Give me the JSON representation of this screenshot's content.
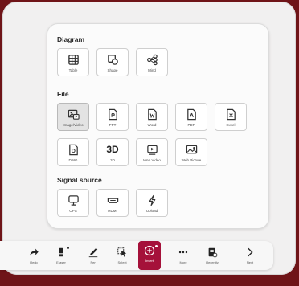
{
  "panel": {
    "sections": {
      "diagram": {
        "title": "Diagram",
        "items": [
          {
            "label": "Table",
            "icon": "table-icon"
          },
          {
            "label": "Shape",
            "icon": "shape-icon"
          },
          {
            "label": "Mind",
            "icon": "mind-map-icon"
          }
        ]
      },
      "file": {
        "title": "File",
        "row1": [
          {
            "label": "Image/Video",
            "icon": "image-video-icon",
            "selected": true
          },
          {
            "label": "PPT",
            "icon": "ppt-file-icon"
          },
          {
            "label": "Word",
            "icon": "word-file-icon"
          },
          {
            "label": "PDF",
            "icon": "pdf-file-icon"
          },
          {
            "label": "Excel",
            "icon": "excel-file-icon"
          }
        ],
        "row2": [
          {
            "label": "DWG",
            "icon": "dwg-file-icon"
          },
          {
            "label": "3D",
            "icon": "3d-icon",
            "glyph": "3D"
          },
          {
            "label": "Web Video",
            "icon": "web-video-icon"
          },
          {
            "label": "Web Picture",
            "icon": "web-picture-icon"
          }
        ]
      },
      "signal": {
        "title": "Signal source",
        "items": [
          {
            "label": "OPS",
            "icon": "ops-icon"
          },
          {
            "label": "HDMI",
            "icon": "hdmi-icon"
          },
          {
            "label": "Upload",
            "icon": "upload-icon"
          }
        ]
      }
    }
  },
  "toolbar": {
    "items": [
      {
        "label": "Redo",
        "icon": "redo-icon"
      },
      {
        "label": "Eraser",
        "icon": "eraser-icon"
      },
      {
        "label": "Pen",
        "icon": "pen-icon"
      },
      {
        "label": "Select",
        "icon": "select-icon"
      },
      {
        "label": "Insert",
        "icon": "insert-icon",
        "active": true
      },
      {
        "label": "More",
        "icon": "more-icon"
      },
      {
        "label": "Recently",
        "icon": "recently-icon"
      },
      {
        "label": "Next",
        "icon": "next-icon"
      }
    ]
  },
  "colors": {
    "background": "#6f1418",
    "accent": "#a5113a",
    "panel": "#fbfbfb"
  }
}
